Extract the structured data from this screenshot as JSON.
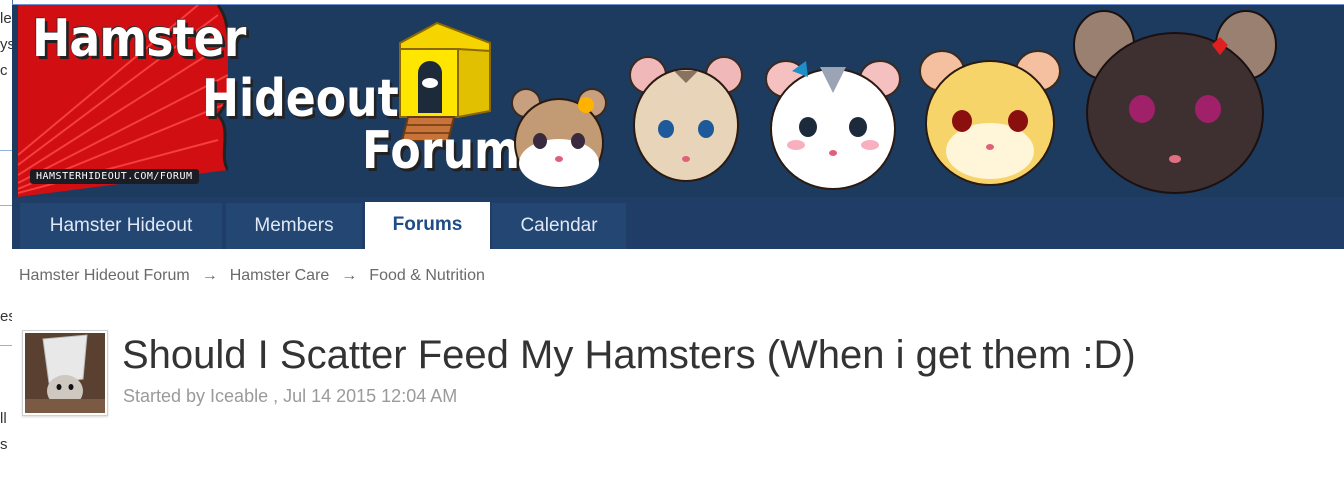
{
  "edge_fragments": [
    "le",
    "ys",
    "c",
    "es",
    "ll",
    "s"
  ],
  "banner": {
    "logo_line1": "Hamster",
    "logo_line2": "Hideout",
    "logo_line3": "Forum",
    "logo_url": "HAMSTERHIDEOUT.COM/FORUM"
  },
  "nav": {
    "tabs": [
      {
        "label": "Hamster Hideout",
        "active": false
      },
      {
        "label": "Members",
        "active": false
      },
      {
        "label": "Forums",
        "active": true
      },
      {
        "label": "Calendar",
        "active": false
      }
    ]
  },
  "breadcrumb": {
    "items": [
      "Hamster Hideout Forum",
      "Hamster Care",
      "Food & Nutrition"
    ],
    "separator": "→"
  },
  "topic": {
    "title": "Should I Scatter Feed My Hamsters (When i get them :D)",
    "meta": "Started by Iceable , Jul 14 2015 12:04 AM"
  },
  "colors": {
    "banner_bg": "#1d3a5f",
    "nav_bg": "#1f3d66",
    "active_tab_text": "#1e4c86"
  }
}
